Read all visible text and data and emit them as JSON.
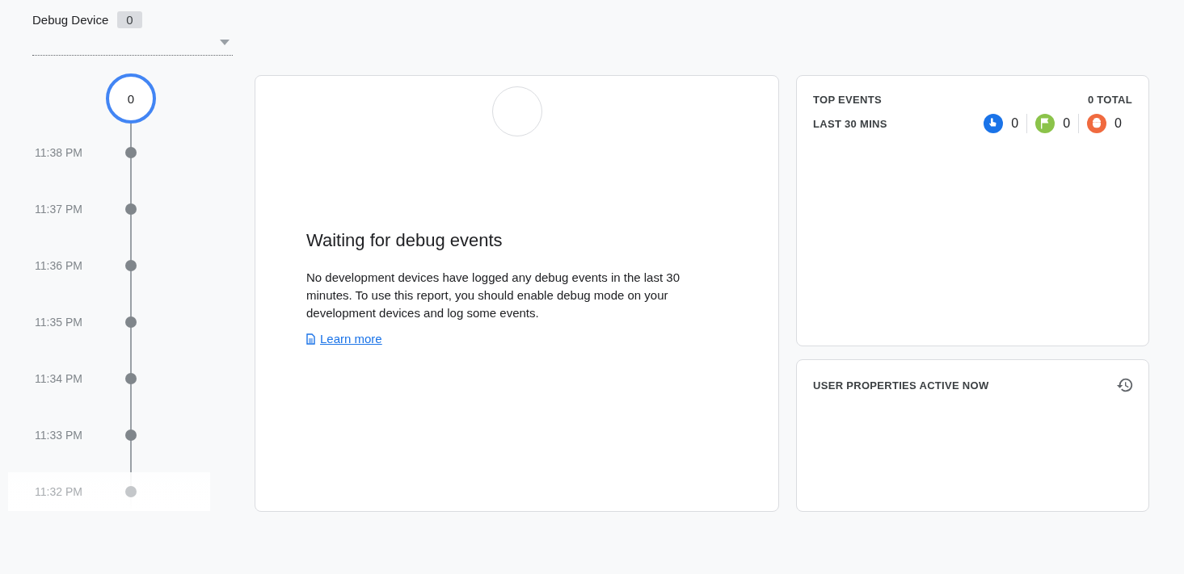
{
  "device_selector": {
    "label": "Debug Device",
    "count": "0"
  },
  "timeline": {
    "count": "0",
    "times": [
      {
        "time": "11:38 PM",
        "faded": false
      },
      {
        "time": "11:37 PM",
        "faded": false
      },
      {
        "time": "11:36 PM",
        "faded": false
      },
      {
        "time": "11:35 PM",
        "faded": false
      },
      {
        "time": "11:34 PM",
        "faded": false
      },
      {
        "time": "11:33 PM",
        "faded": false
      },
      {
        "time": "11:32 PM",
        "faded": true
      }
    ]
  },
  "main_card": {
    "title": "Waiting for debug events",
    "body": "No development devices have logged any debug events in the last 30 minutes. To use this report, you should enable debug mode on your development devices and log some events.",
    "link": "Learn more"
  },
  "top_events": {
    "title": "TOP EVENTS",
    "total": "0 TOTAL",
    "period": "LAST 30 MINS",
    "counters": [
      {
        "kind": "touch",
        "color": "#1a73e8",
        "count": "0"
      },
      {
        "kind": "flag",
        "color": "#8bc34a",
        "count": "0"
      },
      {
        "kind": "bug",
        "color": "#f06a3f",
        "count": "0"
      }
    ]
  },
  "user_properties": {
    "title": "USER PROPERTIES ACTIVE NOW"
  }
}
